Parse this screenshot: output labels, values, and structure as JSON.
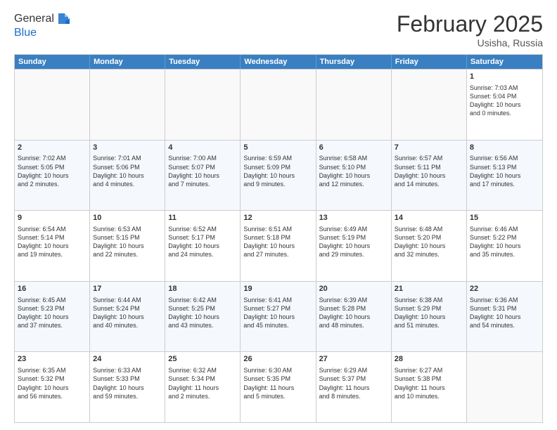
{
  "logo": {
    "line1": "General",
    "line2": "Blue"
  },
  "title": "February 2025",
  "location": "Usisha, Russia",
  "days_of_week": [
    "Sunday",
    "Monday",
    "Tuesday",
    "Wednesday",
    "Thursday",
    "Friday",
    "Saturday"
  ],
  "weeks": [
    [
      {
        "day": "",
        "info": ""
      },
      {
        "day": "",
        "info": ""
      },
      {
        "day": "",
        "info": ""
      },
      {
        "day": "",
        "info": ""
      },
      {
        "day": "",
        "info": ""
      },
      {
        "day": "",
        "info": ""
      },
      {
        "day": "1",
        "info": "Sunrise: 7:03 AM\nSunset: 5:04 PM\nDaylight: 10 hours\nand 0 minutes."
      }
    ],
    [
      {
        "day": "2",
        "info": "Sunrise: 7:02 AM\nSunset: 5:05 PM\nDaylight: 10 hours\nand 2 minutes."
      },
      {
        "day": "3",
        "info": "Sunrise: 7:01 AM\nSunset: 5:06 PM\nDaylight: 10 hours\nand 4 minutes."
      },
      {
        "day": "4",
        "info": "Sunrise: 7:00 AM\nSunset: 5:07 PM\nDaylight: 10 hours\nand 7 minutes."
      },
      {
        "day": "5",
        "info": "Sunrise: 6:59 AM\nSunset: 5:09 PM\nDaylight: 10 hours\nand 9 minutes."
      },
      {
        "day": "6",
        "info": "Sunrise: 6:58 AM\nSunset: 5:10 PM\nDaylight: 10 hours\nand 12 minutes."
      },
      {
        "day": "7",
        "info": "Sunrise: 6:57 AM\nSunset: 5:11 PM\nDaylight: 10 hours\nand 14 minutes."
      },
      {
        "day": "8",
        "info": "Sunrise: 6:56 AM\nSunset: 5:13 PM\nDaylight: 10 hours\nand 17 minutes."
      }
    ],
    [
      {
        "day": "9",
        "info": "Sunrise: 6:54 AM\nSunset: 5:14 PM\nDaylight: 10 hours\nand 19 minutes."
      },
      {
        "day": "10",
        "info": "Sunrise: 6:53 AM\nSunset: 5:15 PM\nDaylight: 10 hours\nand 22 minutes."
      },
      {
        "day": "11",
        "info": "Sunrise: 6:52 AM\nSunset: 5:17 PM\nDaylight: 10 hours\nand 24 minutes."
      },
      {
        "day": "12",
        "info": "Sunrise: 6:51 AM\nSunset: 5:18 PM\nDaylight: 10 hours\nand 27 minutes."
      },
      {
        "day": "13",
        "info": "Sunrise: 6:49 AM\nSunset: 5:19 PM\nDaylight: 10 hours\nand 29 minutes."
      },
      {
        "day": "14",
        "info": "Sunrise: 6:48 AM\nSunset: 5:20 PM\nDaylight: 10 hours\nand 32 minutes."
      },
      {
        "day": "15",
        "info": "Sunrise: 6:46 AM\nSunset: 5:22 PM\nDaylight: 10 hours\nand 35 minutes."
      }
    ],
    [
      {
        "day": "16",
        "info": "Sunrise: 6:45 AM\nSunset: 5:23 PM\nDaylight: 10 hours\nand 37 minutes."
      },
      {
        "day": "17",
        "info": "Sunrise: 6:44 AM\nSunset: 5:24 PM\nDaylight: 10 hours\nand 40 minutes."
      },
      {
        "day": "18",
        "info": "Sunrise: 6:42 AM\nSunset: 5:25 PM\nDaylight: 10 hours\nand 43 minutes."
      },
      {
        "day": "19",
        "info": "Sunrise: 6:41 AM\nSunset: 5:27 PM\nDaylight: 10 hours\nand 45 minutes."
      },
      {
        "day": "20",
        "info": "Sunrise: 6:39 AM\nSunset: 5:28 PM\nDaylight: 10 hours\nand 48 minutes."
      },
      {
        "day": "21",
        "info": "Sunrise: 6:38 AM\nSunset: 5:29 PM\nDaylight: 10 hours\nand 51 minutes."
      },
      {
        "day": "22",
        "info": "Sunrise: 6:36 AM\nSunset: 5:31 PM\nDaylight: 10 hours\nand 54 minutes."
      }
    ],
    [
      {
        "day": "23",
        "info": "Sunrise: 6:35 AM\nSunset: 5:32 PM\nDaylight: 10 hours\nand 56 minutes."
      },
      {
        "day": "24",
        "info": "Sunrise: 6:33 AM\nSunset: 5:33 PM\nDaylight: 10 hours\nand 59 minutes."
      },
      {
        "day": "25",
        "info": "Sunrise: 6:32 AM\nSunset: 5:34 PM\nDaylight: 11 hours\nand 2 minutes."
      },
      {
        "day": "26",
        "info": "Sunrise: 6:30 AM\nSunset: 5:35 PM\nDaylight: 11 hours\nand 5 minutes."
      },
      {
        "day": "27",
        "info": "Sunrise: 6:29 AM\nSunset: 5:37 PM\nDaylight: 11 hours\nand 8 minutes."
      },
      {
        "day": "28",
        "info": "Sunrise: 6:27 AM\nSunset: 5:38 PM\nDaylight: 11 hours\nand 10 minutes."
      },
      {
        "day": "",
        "info": ""
      }
    ]
  ]
}
